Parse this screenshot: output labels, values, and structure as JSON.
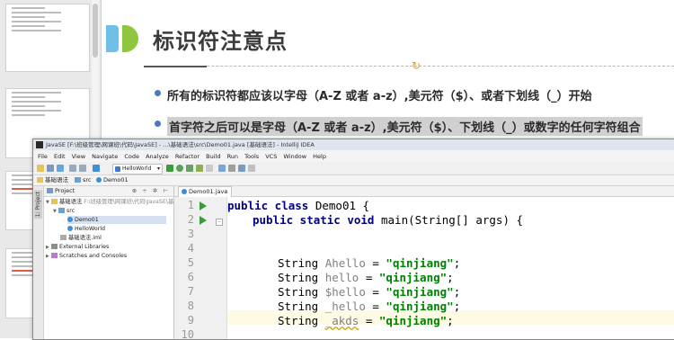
{
  "slide": {
    "title": "标识符注意点",
    "bullets": [
      "所有的标识符都应该以字母（A-Z 或者 a-z）,美元符（$）、或者下划线（_）开始",
      "首字符之后可以是字母（A-Z 或者 a-z）,美元符（$）、下划线（_）或数字的任何字符组合"
    ]
  },
  "ide": {
    "window_title": "JavaSE [F:\\班级管理\\网课班\\代码\\JavaSE] - ...\\基础语法\\src\\Demo01.java [基础语法] - IntelliJ IDEA",
    "menu": [
      "File",
      "Edit",
      "View",
      "Navigate",
      "Code",
      "Analyze",
      "Refactor",
      "Build",
      "Run",
      "Tools",
      "VCS",
      "Window",
      "Help"
    ],
    "run_config": "HelloWorld",
    "breadcrumb": [
      "基础语法",
      "src",
      "Demo01"
    ],
    "tool_strip_label": "1: Project",
    "project_panel": {
      "title": "Project",
      "tools": "⊕ ÷ ✲ ⊢",
      "tree": {
        "root_name": "基础语法",
        "root_path": "F:\\班级管理\\网课班\\代码\\JavaSE\\基础",
        "src": "src",
        "demo01": "Demo01",
        "helloworld": "HelloWorld",
        "iml": "基础语法.iml",
        "external": "External Libraries",
        "scratches": "Scratches and Consoles"
      }
    },
    "editor": {
      "tab_label": "Demo01.java",
      "line_numbers": [
        "1",
        "2",
        "3",
        "4",
        "5",
        "6",
        "7",
        "8",
        "9",
        "10"
      ],
      "code": {
        "l1_kw": "public class",
        "l1_rest": " Demo01 {",
        "l2_kw": "public static void",
        "l2_rest": " main(String[] args) {",
        "l5_type": "String ",
        "l5_var": "Ahello",
        "l5_eq": " = ",
        "l5_str": "\"qinjiang\"",
        "l6_type": "String ",
        "l6_var": "hello",
        "l6_eq": " = ",
        "l6_str": "\"qinjiang\"",
        "l7_type": "String ",
        "l7_var": "$hello",
        "l7_eq": " = ",
        "l7_str": "\"qinjiang\"",
        "l8_type": "String ",
        "l8_var": "_hello",
        "l8_eq": " = ",
        "l8_str": "\"qinjiang\"",
        "l9_type": "String ",
        "l9_var": "_akds",
        "l9_eq": " = ",
        "l9_str": "\"qinjiang\"",
        "semi": ";"
      }
    }
  }
}
